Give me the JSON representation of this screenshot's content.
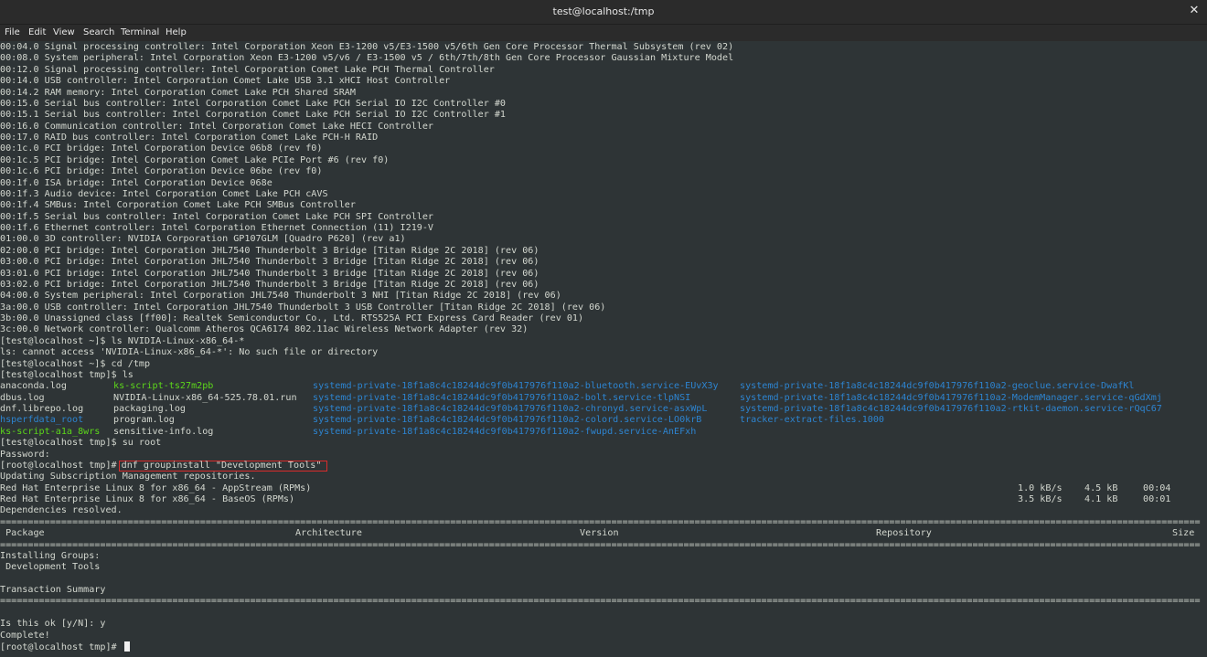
{
  "window": {
    "title": "test@localhost:/tmp"
  },
  "menu": [
    "File",
    "Edit",
    "View",
    "Search",
    "Terminal",
    "Help"
  ],
  "lspci_lines": [
    "00:04.0 Signal processing controller: Intel Corporation Xeon E3-1200 v5/E3-1500 v5/6th Gen Core Processor Thermal Subsystem (rev 02)",
    "00:08.0 System peripheral: Intel Corporation Xeon E3-1200 v5/v6 / E3-1500 v5 / 6th/7th/8th Gen Core Processor Gaussian Mixture Model",
    "00:12.0 Signal processing controller: Intel Corporation Comet Lake PCH Thermal Controller",
    "00:14.0 USB controller: Intel Corporation Comet Lake USB 3.1 xHCI Host Controller",
    "00:14.2 RAM memory: Intel Corporation Comet Lake PCH Shared SRAM",
    "00:15.0 Serial bus controller: Intel Corporation Comet Lake PCH Serial IO I2C Controller #0",
    "00:15.1 Serial bus controller: Intel Corporation Comet Lake PCH Serial IO I2C Controller #1",
    "00:16.0 Communication controller: Intel Corporation Comet Lake HECI Controller",
    "00:17.0 RAID bus controller: Intel Corporation Comet Lake PCH-H RAID",
    "00:1c.0 PCI bridge: Intel Corporation Device 06b8 (rev f0)",
    "00:1c.5 PCI bridge: Intel Corporation Comet Lake PCIe Port #6 (rev f0)",
    "00:1c.6 PCI bridge: Intel Corporation Device 06be (rev f0)",
    "00:1f.0 ISA bridge: Intel Corporation Device 068e",
    "00:1f.3 Audio device: Intel Corporation Comet Lake PCH cAVS",
    "00:1f.4 SMBus: Intel Corporation Comet Lake PCH SMBus Controller",
    "00:1f.5 Serial bus controller: Intel Corporation Comet Lake PCH SPI Controller",
    "00:1f.6 Ethernet controller: Intel Corporation Ethernet Connection (11) I219-V",
    "01:00.0 3D controller: NVIDIA Corporation GP107GLM [Quadro P620] (rev a1)",
    "02:00.0 PCI bridge: Intel Corporation JHL7540 Thunderbolt 3 Bridge [Titan Ridge 2C 2018] (rev 06)",
    "03:00.0 PCI bridge: Intel Corporation JHL7540 Thunderbolt 3 Bridge [Titan Ridge 2C 2018] (rev 06)",
    "03:01.0 PCI bridge: Intel Corporation JHL7540 Thunderbolt 3 Bridge [Titan Ridge 2C 2018] (rev 06)",
    "03:02.0 PCI bridge: Intel Corporation JHL7540 Thunderbolt 3 Bridge [Titan Ridge 2C 2018] (rev 06)",
    "04:00.0 System peripheral: Intel Corporation JHL7540 Thunderbolt 3 NHI [Titan Ridge 2C 2018] (rev 06)",
    "3a:00.0 USB controller: Intel Corporation JHL7540 Thunderbolt 3 USB Controller [Titan Ridge 2C 2018] (rev 06)",
    "3b:00.0 Unassigned class [ff00]: Realtek Semiconductor Co., Ltd. RTS525A PCI Express Card Reader (rev 01)",
    "3c:00.0 Network controller: Qualcomm Atheros QCA6174 802.11ac Wireless Network Adapter (rev 32)"
  ],
  "session1": [
    "[test@localhost ~]$ ls NVIDIA-Linux-x86_64-*",
    "ls: cannot access 'NVIDIA-Linux-x86_64-*': No such file or directory",
    "[test@localhost ~]$ cd /tmp",
    "[test@localhost tmp]$ ls"
  ],
  "ls_rows": [
    [
      {
        "text": "anaconda.log",
        "type": "file"
      },
      {
        "text": "ks-script-ts27m2pb",
        "type": "exec"
      },
      {
        "text": "systemd-private-18f1a8c4c18244dc9f0b417976f110a2-bluetooth.service-EUvX3y",
        "type": "dir"
      },
      {
        "text": "systemd-private-18f1a8c4c18244dc9f0b417976f110a2-geoclue.service-DwafKl",
        "type": "dir"
      }
    ],
    [
      {
        "text": "dbus.log",
        "type": "file"
      },
      {
        "text": "NVIDIA-Linux-x86_64-525.78.01.run",
        "type": "file"
      },
      {
        "text": "systemd-private-18f1a8c4c18244dc9f0b417976f110a2-bolt.service-tlpNSI",
        "type": "dir"
      },
      {
        "text": "systemd-private-18f1a8c4c18244dc9f0b417976f110a2-ModemManager.service-qGdXmj",
        "type": "dir"
      }
    ],
    [
      {
        "text": "dnf.librepo.log",
        "type": "file"
      },
      {
        "text": "packaging.log",
        "type": "file"
      },
      {
        "text": "systemd-private-18f1a8c4c18244dc9f0b417976f110a2-chronyd.service-asxWpL",
        "type": "dir"
      },
      {
        "text": "systemd-private-18f1a8c4c18244dc9f0b417976f110a2-rtkit-daemon.service-rQqC67",
        "type": "dir"
      }
    ],
    [
      {
        "text": "hsperfdata_root",
        "type": "dir"
      },
      {
        "text": "program.log",
        "type": "file"
      },
      {
        "text": "systemd-private-18f1a8c4c18244dc9f0b417976f110a2-colord.service-LO0krB",
        "type": "dir"
      },
      {
        "text": "tracker-extract-files.1000",
        "type": "dir"
      }
    ],
    [
      {
        "text": "ks-script-a1a_8wrs",
        "type": "exec"
      },
      {
        "text": "sensitive-info.log",
        "type": "file"
      },
      {
        "text": "systemd-private-18f1a8c4c18244dc9f0b417976f110a2-fwupd.service-AnEFxh",
        "type": "dir"
      },
      {
        "text": "",
        "type": "file"
      }
    ]
  ],
  "su": {
    "prompt": "[test@localhost tmp]$ su root",
    "password": "Password:",
    "root_prompt": "[root@localhost tmp]#",
    "command": "dnf groupinstall \"Development Tools\"",
    "updating": "Updating Subscription Management repositories."
  },
  "repos": [
    {
      "name": "Red Hat Enterprise Linux 8 for x86_64 - AppStream (RPMs)",
      "speed": "1.0 kB/s",
      "size": "4.5 kB",
      "time": "00:04"
    },
    {
      "name": "Red Hat Enterprise Linux 8 for x86_64 - BaseOS (RPMs)",
      "speed": "3.5 kB/s",
      "size": "4.1 kB",
      "time": "00:01"
    }
  ],
  "deps_resolved": "Dependencies resolved.",
  "table": {
    "headers": {
      "package": " Package",
      "arch": "Architecture",
      "version": "Version",
      "repository": "Repository",
      "size": "Size"
    },
    "installing": "Installing Groups:",
    "group": " Development Tools",
    "summary": "Transaction Summary"
  },
  "tail": {
    "question": "Is this ok [y/N]: y",
    "complete": "Complete!",
    "final_prompt": "[root@localhost tmp]# "
  }
}
